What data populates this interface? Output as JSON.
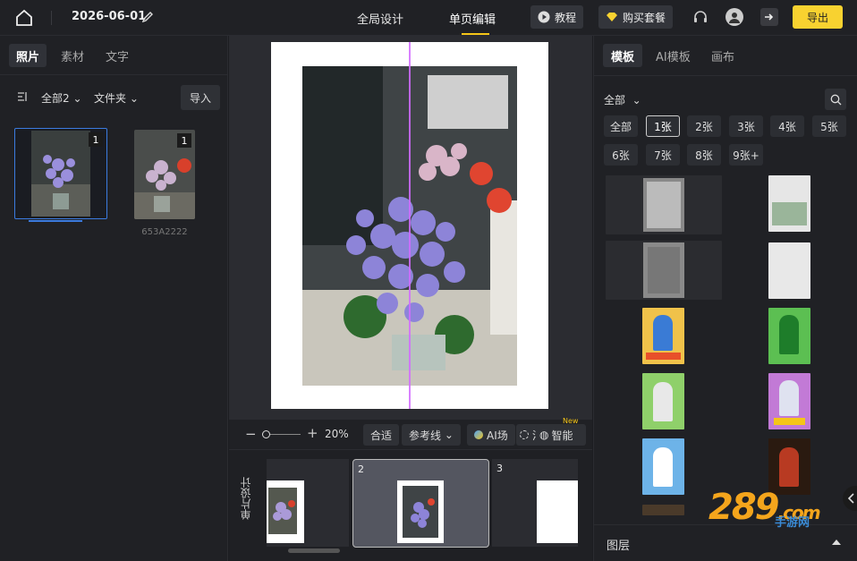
{
  "header": {
    "date": "2026-06-01",
    "tabs": [
      "全局设计",
      "单页编辑"
    ],
    "tutorial": "教程",
    "buy": "购买套餐",
    "export": "导出"
  },
  "left": {
    "tabs": [
      "照片",
      "素材",
      "文字"
    ],
    "filter_all": "全部2",
    "filter_folder": "文件夹",
    "import": "导入",
    "photos": [
      {
        "badge": "1",
        "name": ""
      },
      {
        "badge": "1",
        "name": "653A2222"
      }
    ]
  },
  "center": {
    "zoom": "20%",
    "fit": "合适",
    "guides": "参考线",
    "ai_scene": "AI场",
    "dissolve": "溶图",
    "smart": "智能",
    "new_badge": "New",
    "side_label": "单片设计",
    "pages": [
      "2",
      "3"
    ]
  },
  "right": {
    "tabs": [
      "模板",
      "AI模板",
      "画布"
    ],
    "filter_all": "全部",
    "chips": [
      "全部",
      "1张",
      "2张",
      "3张",
      "4张",
      "5张",
      "6张",
      "7张",
      "8张",
      "9张+"
    ],
    "layer_title": "图层"
  },
  "watermark": {
    "number": "289",
    "domain": ".com",
    "sub": "手游网"
  },
  "colors": {
    "accent": "#f8d230",
    "guide": "#d26bff",
    "bg": "#202125"
  }
}
